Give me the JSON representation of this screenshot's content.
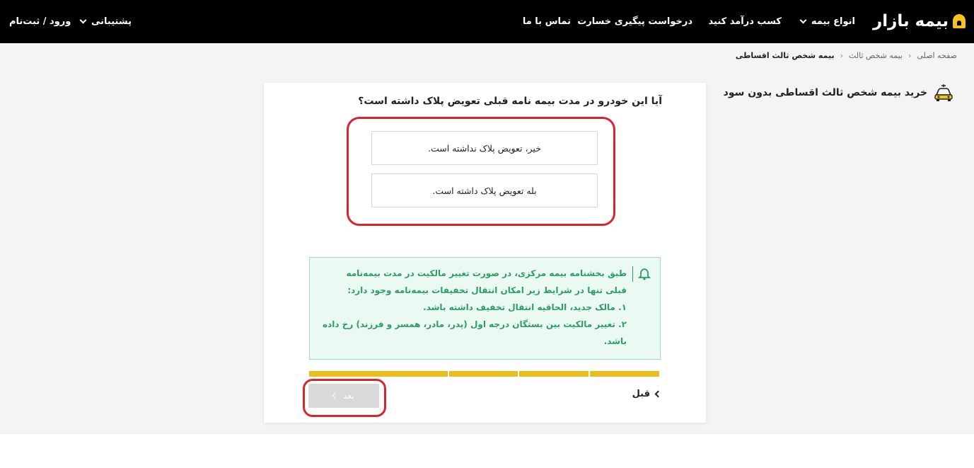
{
  "header": {
    "logo_text": "بیمه بازار",
    "nav": {
      "insurance_types": "انواع بیمه",
      "earn_money": "کسب درآمد کنید",
      "claim_tracking": "درخواست پیگیری خسارت",
      "contact": "تماس با ما",
      "support": "پشتیبانی",
      "login": "ورود / ثبت‌نام"
    }
  },
  "breadcrumb": {
    "home": "صفحه اصلی",
    "third_party": "بیمه شخص ثالث",
    "current": "بیمه شخص ثالث اقساطی"
  },
  "side": {
    "title": "خرید بیمه شخص ثالث اقساطی بدون سود",
    "icon": "car-icon"
  },
  "form": {
    "question": "آیا این خودرو در مدت بیمه نامه قبلی تعویض پلاک داشته است؟",
    "options": [
      "خیر، تعویض پلاک نداشته است.",
      "بله تعویض پلاک داشته است."
    ],
    "notice": {
      "line1": "طبق بخشنامه بیمه مرکزی، در صورت تغییر مالکیت در مدت بیمه‌نامه قبلی تنها در شرایط زیر امکان انتقال تخفیفات بیمه‌نامه وجود دارد:",
      "line2": "۱. مالک جدید، الحاقیه انتقال تخفیف داشته باشد.",
      "line3": "۲. تغییر مالکیت بین بستگان درجه اول (پدر، مادر، همسر و فرزند) رخ داده باشد."
    },
    "progress_steps": 5,
    "prev_label": "قبل",
    "next_label": "بعد"
  },
  "colors": {
    "accent_yellow": "#e9bd1e",
    "notice_green": "#2e9c67",
    "highlight_red": "#d6262d"
  }
}
